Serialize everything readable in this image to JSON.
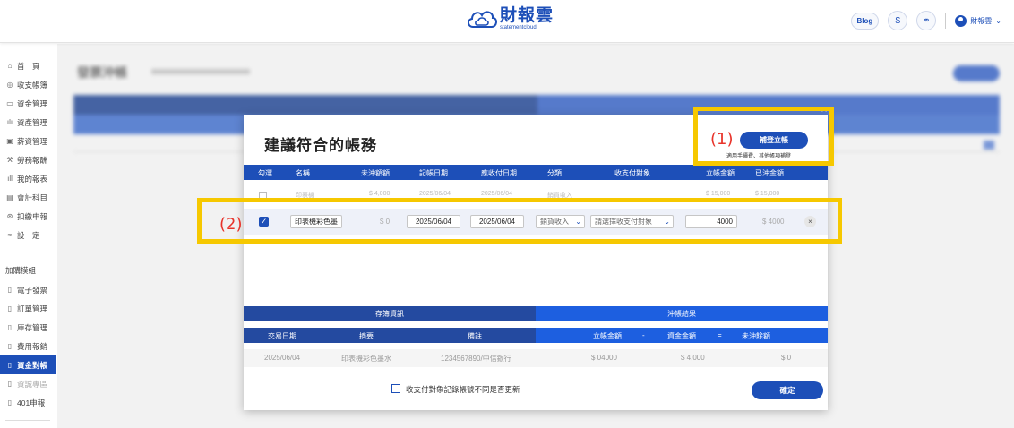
{
  "header": {
    "logo_cn": "財報雲",
    "logo_en": "statementcloud",
    "blog_label": "Blog",
    "user_name": "財報雲"
  },
  "sidebar": {
    "items": [
      {
        "label": "首　頁",
        "icon": "home-icon"
      },
      {
        "label": "收支帳簿",
        "icon": "coin-icon"
      },
      {
        "label": "資金管理",
        "icon": "wallet-icon"
      },
      {
        "label": "資產管理",
        "icon": "asset-icon"
      },
      {
        "label": "薪資管理",
        "icon": "salary-icon"
      },
      {
        "label": "勞務報酬",
        "icon": "labor-icon"
      },
      {
        "label": "我的報表",
        "icon": "report-icon"
      },
      {
        "label": "會計科目",
        "icon": "ledger-icon"
      },
      {
        "label": "扣繳申報",
        "icon": "tax-icon"
      },
      {
        "label": "設　定",
        "icon": "settings-icon"
      }
    ],
    "group_label": "加購模組",
    "module_items": [
      {
        "label": "電子發票",
        "icon": "doc-icon"
      },
      {
        "label": "訂單管理",
        "icon": "doc-icon"
      },
      {
        "label": "庫存管理",
        "icon": "doc-icon"
      },
      {
        "label": "費用報銷",
        "icon": "doc-icon"
      },
      {
        "label": "資金對帳",
        "icon": "doc-icon",
        "active": true
      },
      {
        "label": "資誠專區",
        "icon": "doc-icon",
        "disabled": true
      },
      {
        "label": "401申報",
        "icon": "doc-icon"
      }
    ]
  },
  "background": {
    "title": "發票沖帳"
  },
  "modal": {
    "title": "建議符合的帳務",
    "entry_button": "補登立帳",
    "entry_hint": "適用手續費、其他帳項補登",
    "columns": [
      "勾選",
      "名稱",
      "未沖額額",
      "記帳日期",
      "應收付日期",
      "分類",
      "收支付對象",
      "立帳金額",
      "已沖金額"
    ],
    "ghost_row": {
      "name": "印表機",
      "unpaid": "$ 4,000",
      "date1": "2025/06/04",
      "date2": "2025/06/04",
      "category": "銷貨收入",
      "amount": "$ 15,000",
      "offset": "$ 15,000"
    },
    "selected_row": {
      "checked": "✓",
      "name": "印表機彩色墨",
      "unpaid": "$ 0",
      "date1": "2025/06/04",
      "date2": "2025/06/04",
      "category": "銷貨收入",
      "counterparty_placeholder": "請選擇收支付對象",
      "amount": "4000",
      "offset": "$ 4000",
      "remove": "×"
    },
    "info_left_header": "存簿資訊",
    "info_right_header": "沖帳結果",
    "info_left_columns": [
      "交易日期",
      "摘要",
      "備註"
    ],
    "info_right_columns": [
      "立帳金額",
      "-",
      "資金金額",
      "=",
      "未沖餘額"
    ],
    "info_row": {
      "date": "2025/06/04",
      "summary": "印表機彩色墨水",
      "note": "1234567890/中信銀行",
      "amount": "$ 04000",
      "fund": "$ 4,000",
      "balance": "$ 0"
    },
    "update_label": "收支付對象記錄帳號不同是否更新",
    "confirm_button": "確定"
  },
  "annotations": {
    "label1": "(1)",
    "label2": "(2)",
    "highlight_color": "#f6c800",
    "label_color": "#e8332a"
  },
  "colors": {
    "primary": "#1d4fb8",
    "header_dark": "#244aa0",
    "header_bright": "#1d5fe0"
  }
}
